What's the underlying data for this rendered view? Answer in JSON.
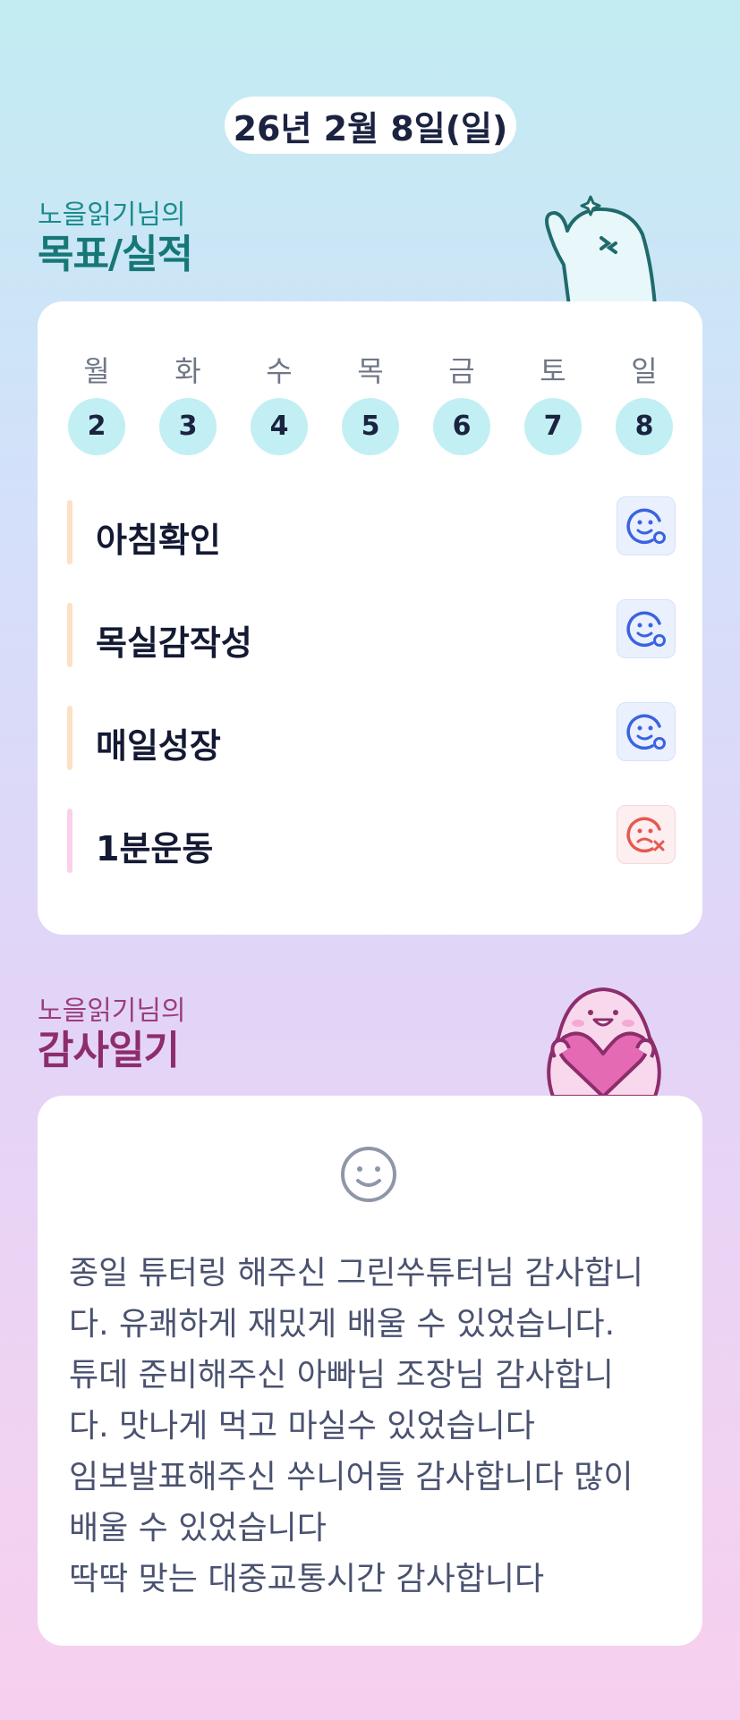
{
  "header": {
    "date": "26년 2월 8일(일)"
  },
  "goals_section": {
    "subtitle": "노을읽기님의",
    "title": "목표/실적",
    "weekdays": [
      {
        "label": "월",
        "num": "2"
      },
      {
        "label": "화",
        "num": "3"
      },
      {
        "label": "수",
        "num": "4"
      },
      {
        "label": "목",
        "num": "5"
      },
      {
        "label": "금",
        "num": "6"
      },
      {
        "label": "토",
        "num": "7"
      },
      {
        "label": "일",
        "num": "8"
      }
    ],
    "goals": [
      {
        "text": "아침확인",
        "status": "achieved",
        "bar_color": "#fde1c4"
      },
      {
        "text": "목실감작성",
        "status": "achieved",
        "bar_color": "#fde1c4"
      },
      {
        "text": "매일성장",
        "status": "achieved",
        "bar_color": "#fde1c4"
      },
      {
        "text": "1분운동",
        "status": "missed",
        "bar_color": "#f9d1ea"
      }
    ]
  },
  "thanks_section": {
    "subtitle": "노을읽기님의",
    "title": "감사일기",
    "mood_icon": "smile-icon",
    "lines": [
      "종일 튜터링 해주신 그린쑤튜터님 감사합니",
      "다. 유쾌하게 재밌게 배울 수 있었습니다.",
      "튜데 준비해주신 아빠님 조장님 감사합니",
      "다. 맛나게 먹고 마실수 있었습니다",
      "임보발표해주신 쑤니어들 감사합니다 많이",
      "배울 수 있었습니다",
      "딱딱 맞는 대중교통시간 감사합니다"
    ]
  },
  "colors": {
    "achieved": "#3a63e0",
    "missed": "#e6584f",
    "day_circle": "#c2eff3",
    "teal_heading": "#167876",
    "plum_heading": "#8d2d6b"
  }
}
